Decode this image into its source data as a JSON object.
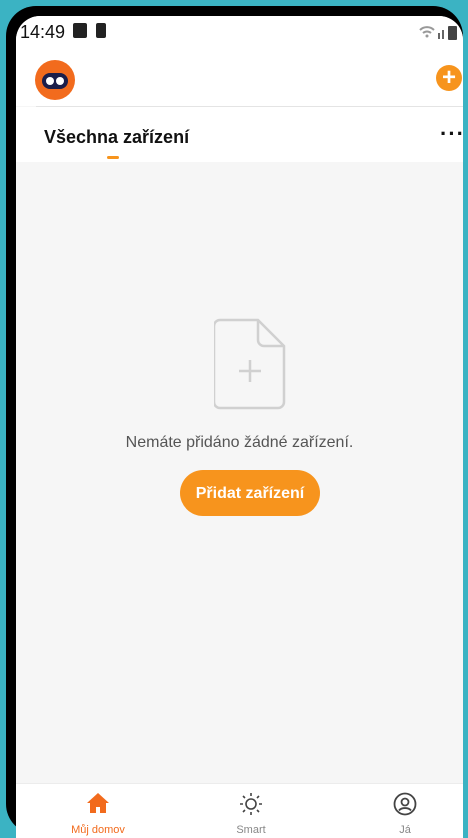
{
  "status_bar": {
    "time": "14:49"
  },
  "header": {
    "add_icon": "plus-circle-icon",
    "accent": "#f7941d"
  },
  "tabs": {
    "title": "Všechna zařízení",
    "more_label": "···"
  },
  "empty_state": {
    "icon": "add-document-icon",
    "message": "Nemáte přidáno žádné zařízení.",
    "button_label": "Přidat zařízení"
  },
  "bottom_nav": {
    "items": [
      {
        "label": "Můj domov",
        "icon": "home-icon",
        "active": true
      },
      {
        "label": "Smart",
        "icon": "sun-icon",
        "active": false
      },
      {
        "label": "Já",
        "icon": "user-icon",
        "active": false
      }
    ]
  }
}
